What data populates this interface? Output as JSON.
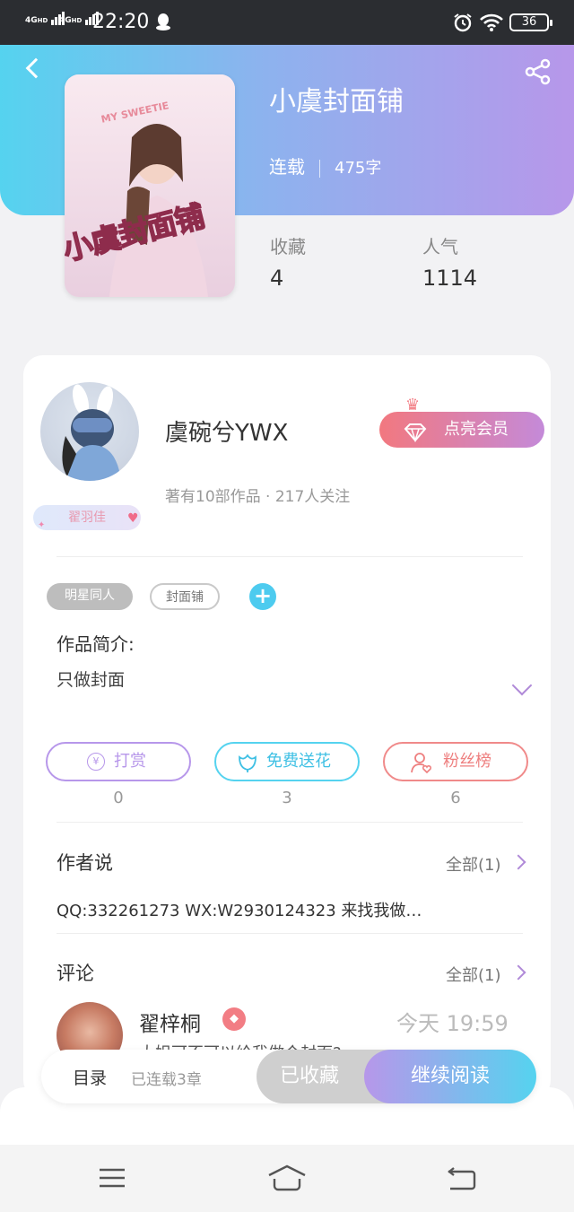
{
  "statusbar": {
    "network1": "4G HD",
    "network2": "4G HD",
    "time": "22:20",
    "battery": "36"
  },
  "book": {
    "title": "小虞封面铺",
    "status": "连载",
    "word_count": "475字",
    "cover_title": "小虞封面铺",
    "cover_sticker": "MY SWEETIE",
    "stats": [
      {
        "label": "收藏",
        "value": "4"
      },
      {
        "label": "人气",
        "value": "1114"
      }
    ]
  },
  "author": {
    "name": "虞碗兮YWX",
    "meta": "著有10部作品 · 217人关注",
    "badge": "翟羽佳",
    "vip_button": "点亮会员"
  },
  "tags": [
    "明星同人",
    "封面铺"
  ],
  "intro": {
    "label": "作品简介:",
    "text": "只做封面"
  },
  "actions": [
    {
      "label": "打赏",
      "icon": "yen-icon",
      "count": "0"
    },
    {
      "label": "免费送花",
      "icon": "flower-icon",
      "count": "3"
    },
    {
      "label": "粉丝榜",
      "icon": "user-heart-icon",
      "count": "6"
    }
  ],
  "author_says": {
    "title": "作者说",
    "link": "全部(1)",
    "text": "QQ:332261273 WX:W2930124323 来找我做…"
  },
  "comments": {
    "title": "评论",
    "link": "全部(1)",
    "items": [
      {
        "name": "翟梓桐",
        "time": "今天 19:59",
        "text": "大姐可不可以给我做个封面?"
      }
    ]
  },
  "bottombar": {
    "toc": "目录",
    "toc_sub": "已连载3章",
    "favorited": "已收藏",
    "continue": "继续阅读"
  }
}
